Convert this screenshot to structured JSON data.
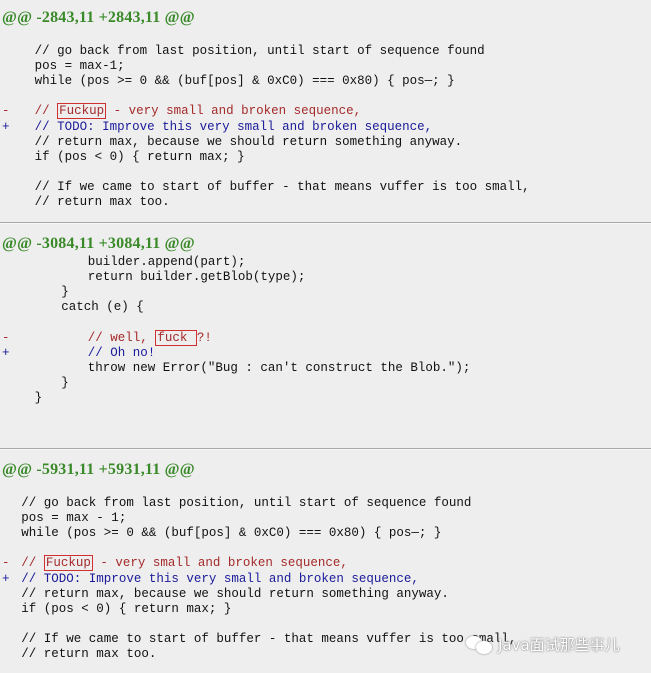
{
  "hunks": [
    {
      "header": "@@ -2843,11 +2843,11 @@",
      "lines": [
        {
          "type": "ctx",
          "indent": 4,
          "text": "// go back from last position, until start of sequence found"
        },
        {
          "type": "ctx",
          "indent": 4,
          "text": "pos = max-1;"
        },
        {
          "type": "ctx",
          "indent": 4,
          "text": "while (pos >= 0 && (buf[pos] & 0xC0) === 0x80) { pos—; }"
        },
        {
          "type": "blank"
        },
        {
          "type": "del",
          "marker": "-",
          "indent": 4,
          "pre": "// ",
          "boxed": "Fuckup",
          "post": " - very small and broken sequence,"
        },
        {
          "type": "add",
          "marker": "+",
          "indent": 4,
          "text": "// TODO: Improve this very small and broken sequence,"
        },
        {
          "type": "ctx",
          "indent": 4,
          "text": "// return max, because we should return something anyway."
        },
        {
          "type": "ctx",
          "indent": 4,
          "text": "if (pos < 0) { return max; }"
        },
        {
          "type": "blank"
        },
        {
          "type": "ctx",
          "indent": 4,
          "text": "// If we came to start of buffer - that means vuffer is too small,"
        },
        {
          "type": "ctx",
          "indent": 4,
          "text": "// return max too."
        }
      ]
    },
    {
      "header": "@@ -3084,11 +3084,11 @@",
      "lines": [
        {
          "type": "ctx",
          "indent": 12,
          "text": "builder.append(part);"
        },
        {
          "type": "ctx",
          "indent": 12,
          "text": "return builder.getBlob(type);"
        },
        {
          "type": "ctx",
          "indent": 8,
          "text": "}"
        },
        {
          "type": "ctx",
          "indent": 8,
          "text": "catch (e) {"
        },
        {
          "type": "blank"
        },
        {
          "type": "del",
          "marker": "-",
          "indent": 12,
          "pre": "// well, ",
          "boxed": "fuck ",
          "post": "?!"
        },
        {
          "type": "add",
          "marker": "+",
          "indent": 12,
          "text": "// Oh no!"
        },
        {
          "type": "ctx",
          "indent": 12,
          "text": "throw new Error(\"Bug : can't construct the Blob.\");"
        },
        {
          "type": "ctx",
          "indent": 8,
          "text": "}"
        },
        {
          "type": "ctx",
          "indent": 4,
          "text": "}"
        }
      ]
    },
    {
      "header": "@@ -5931,11 +5931,11 @@",
      "lines": [
        {
          "type": "ctx",
          "indent": 2,
          "text": "// go back from last position, until start of sequence found"
        },
        {
          "type": "ctx",
          "indent": 2,
          "text": "pos = max - 1;"
        },
        {
          "type": "ctx",
          "indent": 2,
          "text": "while (pos >= 0 && (buf[pos] & 0xC0) === 0x80) { pos—; }"
        },
        {
          "type": "blank"
        },
        {
          "type": "del",
          "marker": "-",
          "indent": 2,
          "pre": "// ",
          "boxed": "Fuckup",
          "post": " - very small and broken sequence,"
        },
        {
          "type": "add",
          "marker": "+",
          "indent": 2,
          "text": "// TODO: Improve this very small and broken sequence,"
        },
        {
          "type": "ctx",
          "indent": 2,
          "text": "// return max, because we should return something anyway."
        },
        {
          "type": "ctx",
          "indent": 2,
          "text": "if (pos < 0) { return max; }"
        },
        {
          "type": "blank"
        },
        {
          "type": "ctx",
          "indent": 2,
          "text": "// If we came to start of buffer - that means vuffer is too small,"
        },
        {
          "type": "ctx",
          "indent": 2,
          "text": "// return max too."
        }
      ]
    }
  ],
  "watermark": {
    "icon": "wechat-icon",
    "text": "Java面试那些事儿"
  },
  "colors": {
    "hunk_header": "#3a8a2a",
    "deleted": "#a52a2a",
    "added": "#1a1a9a",
    "highlight_box": "#d03030"
  }
}
